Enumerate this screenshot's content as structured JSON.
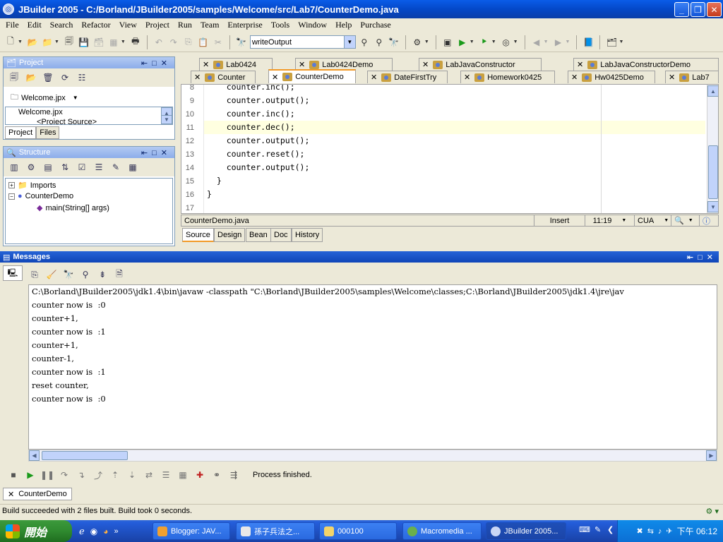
{
  "window": {
    "title": "JBuilder 2005 - C:/Borland/JBuilder2005/samples/Welcome/src/Lab7/CounterDemo.java",
    "minimize": "_",
    "restore": "❐",
    "close": "✕"
  },
  "menu": [
    "File",
    "Edit",
    "Search",
    "Refactor",
    "View",
    "Project",
    "Run",
    "Team",
    "Enterprise",
    "Tools",
    "Window",
    "Help",
    "Purchase"
  ],
  "toolbar": {
    "combo_value": "writeOutput"
  },
  "project_panel": {
    "title": "Project",
    "project_selector": "Welcome.jpx",
    "tree": [
      "Welcome.jpx",
      "<Project Source>"
    ],
    "tabs": [
      "Project",
      "Files"
    ]
  },
  "structure_panel": {
    "title": "Structure",
    "tree": [
      "Imports",
      "CounterDemo",
      "main(String[] args)"
    ]
  },
  "editor": {
    "tabs_row1": [
      "Lab0424",
      "Lab0424Demo",
      "LabJavaConstructor",
      "LabJavaConstructorDemo"
    ],
    "tabs_row2": [
      "Counter",
      "CounterDemo",
      "DateFirstTry",
      "Homework0425",
      "Hw0425Demo",
      "Lab7"
    ],
    "active_tab": "CounterDemo",
    "line_numbers": [
      "8",
      "9",
      "10",
      "11",
      "12",
      "13",
      "14",
      "15",
      "16",
      "17"
    ],
    "code_lines": [
      "    counter.inc();",
      "    counter.output();",
      "    counter.inc();",
      "    counter.dec();",
      "    counter.output();",
      "    counter.reset();",
      "    counter.output();",
      "  }",
      "}",
      ""
    ],
    "current_line": "11",
    "status": {
      "file": "CounterDemo.java",
      "mode": "Insert",
      "position": "11:19",
      "keymap": "CUA"
    },
    "bottom_tabs": [
      "Source",
      "Design",
      "Bean",
      "Doc",
      "History"
    ]
  },
  "messages": {
    "title": "Messages",
    "lines": [
      "C:\\Borland\\JBuilder2005\\jdk1.4\\bin\\javaw -classpath \"C:\\Borland\\JBuilder2005\\samples\\Welcome\\classes;C:\\Borland\\JBuilder2005\\jdk1.4\\jre\\jav",
      "counter now is  :0",
      "counter+1,",
      "counter now is  :1",
      "counter+1,",
      "counter-1,",
      "counter now is  :1",
      "reset counter,",
      "counter now is  :0"
    ],
    "process_status": "Process finished.",
    "run_tab": "CounterDemo"
  },
  "statusbar": {
    "text": "Build succeeded with 2 files built.  Build took 0 seconds."
  },
  "taskbar": {
    "start": "開始",
    "tasks": [
      "Blogger: JAV...",
      "孫子兵法之...",
      "000100",
      "Macromedia ...",
      "JBuilder 2005..."
    ],
    "clock": "下午 06:12"
  }
}
